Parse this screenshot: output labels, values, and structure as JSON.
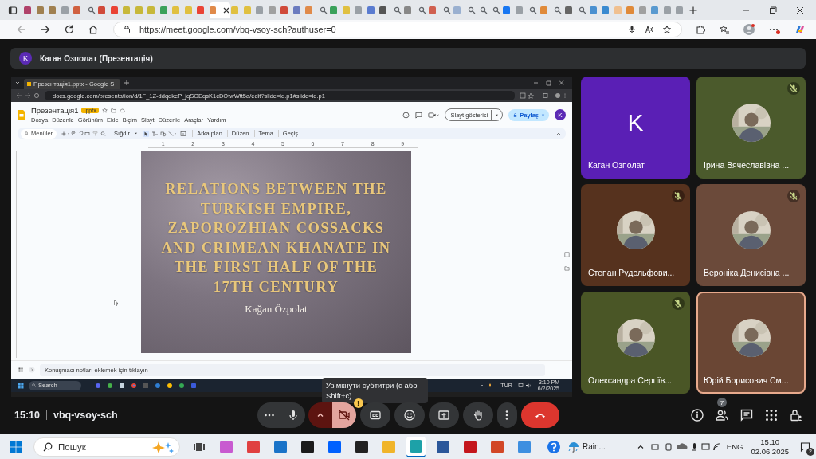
{
  "browser": {
    "tabs": [
      {
        "kind": "page",
        "color": "#b0426a",
        "selected": false
      },
      {
        "kind": "page",
        "color": "#a08050",
        "selected": false
      },
      {
        "kind": "page",
        "color": "#a08050",
        "selected": false
      },
      {
        "kind": "page",
        "color": "#9aa0a6",
        "selected": false
      },
      {
        "kind": "page",
        "color": "#d06040",
        "selected": false
      },
      {
        "kind": "search",
        "color": "#5f6368",
        "selected": false
      },
      {
        "kind": "page",
        "color": "#d04a3a",
        "selected": false
      },
      {
        "kind": "page",
        "color": "#ea4335",
        "selected": false
      },
      {
        "kind": "page",
        "color": "#c7b83a",
        "selected": false
      },
      {
        "kind": "page",
        "color": "#c7b83a",
        "selected": false
      },
      {
        "kind": "page",
        "color": "#c7b83a",
        "selected": false
      },
      {
        "kind": "page",
        "color": "#3aa15a",
        "selected": false
      },
      {
        "kind": "page",
        "color": "#e0c040",
        "selected": false
      },
      {
        "kind": "page",
        "color": "#e0c040",
        "selected": false
      },
      {
        "kind": "page",
        "color": "#ea4335",
        "selected": false
      },
      {
        "kind": "page",
        "color": "#e08a4a",
        "selected": true
      },
      {
        "kind": "page",
        "color": "#e0c040",
        "selected": false
      },
      {
        "kind": "page",
        "color": "#e0c040",
        "selected": false
      },
      {
        "kind": "page",
        "color": "#9aa0a6",
        "selected": false
      },
      {
        "kind": "page",
        "color": "#a0a0a0",
        "selected": false
      },
      {
        "kind": "page",
        "color": "#d04a3a",
        "selected": false
      },
      {
        "kind": "page",
        "color": "#6b7bbf",
        "selected": false
      },
      {
        "kind": "page",
        "color": "#e08a4a",
        "selected": false
      },
      {
        "kind": "search",
        "color": "#5f6368",
        "selected": false
      },
      {
        "kind": "page",
        "color": "#3aa15a",
        "selected": false
      },
      {
        "kind": "page",
        "color": "#e0c040",
        "selected": false
      },
      {
        "kind": "page",
        "color": "#9aa0a6",
        "selected": false
      },
      {
        "kind": "page",
        "color": "#5a7bd0",
        "selected": false
      },
      {
        "kind": "page",
        "color": "#555555",
        "selected": false
      },
      {
        "kind": "search",
        "color": "#5f6368",
        "selected": false
      },
      {
        "kind": "page",
        "color": "#888888",
        "selected": false
      },
      {
        "kind": "search",
        "color": "#5f6368",
        "selected": false
      },
      {
        "kind": "page",
        "color": "#d06050",
        "selected": false
      },
      {
        "kind": "search",
        "color": "#5f6368",
        "selected": false
      },
      {
        "kind": "page",
        "color": "#9ab0d0",
        "selected": false
      },
      {
        "kind": "search",
        "color": "#5f6368",
        "selected": false
      },
      {
        "kind": "search",
        "color": "#5f6368",
        "selected": false
      },
      {
        "kind": "search",
        "color": "#5f6368",
        "selected": false
      },
      {
        "kind": "page",
        "color": "#1877f2",
        "selected": false
      },
      {
        "kind": "page",
        "color": "#9aa0a6",
        "selected": false
      },
      {
        "kind": "search",
        "color": "#5f6368",
        "selected": false
      },
      {
        "kind": "page",
        "color": "#e08a3a",
        "selected": false
      },
      {
        "kind": "search",
        "color": "#5f6368",
        "selected": false
      },
      {
        "kind": "page",
        "color": "#666666",
        "selected": false
      },
      {
        "kind": "search",
        "color": "#5f6368",
        "selected": false
      },
      {
        "kind": "page",
        "color": "#4a90d0",
        "selected": false
      },
      {
        "kind": "page",
        "color": "#3a8ad0",
        "selected": false
      },
      {
        "kind": "page",
        "color": "#f0c090",
        "selected": false
      },
      {
        "kind": "page",
        "color": "#e08a3a",
        "selected": false
      },
      {
        "kind": "page",
        "color": "#a0a0a0",
        "selected": false
      },
      {
        "kind": "page",
        "color": "#5a9ad0",
        "selected": false
      },
      {
        "kind": "page",
        "color": "#9aa0a6",
        "selected": false
      },
      {
        "kind": "page",
        "color": "#9aa0a6",
        "selected": false
      }
    ],
    "url": "https://meet.google.com/vbq-vsoy-sch?authuser=0"
  },
  "meeting": {
    "presenter_initial": "K",
    "presenter_label": "Каган Озполат (Презентація)",
    "time": "15:10",
    "code": "vbq-vsoy-sch",
    "participants_count": "7"
  },
  "shared_screen": {
    "tab_title": "Презентація1.pptx - Google S",
    "url": "docs.google.com/presentation/d/1F_1Z-ddqqkeP_jqSOEqsK1cDOtwWtt5a/edit?slide=id.p1#slide=id.p1",
    "doc_title": "Презентація1",
    "doc_badge": ".pptx",
    "menus": [
      "Dosya",
      "Düzenle",
      "Görünüm",
      "Ekle",
      "Biçim",
      "Slayt",
      "Düzenle",
      "Araçlar",
      "Yardım"
    ],
    "slideshow_button": "Slayt gösterisi",
    "share_button": "Paylaş",
    "account_initial": "K",
    "search_menus": "Menüler",
    "zoom": "Sığdır",
    "toolbar_buttons": [
      "Arka plan",
      "Düzen",
      "Tema",
      "Geçiş"
    ],
    "ruler": [
      "1",
      "2",
      "3",
      "4",
      "5",
      "6",
      "7",
      "8",
      "9"
    ],
    "slide": {
      "title": "RELATIONS BETWEEN THE TURKISH EMPIRE, ZAPOROZHIAN COSSACKS AND CRIMEAN KHANATE IN THE FIRST HALF OF THE 17TH CENTURY",
      "author": "Kağan Özpolat"
    },
    "notes_placeholder": "Konuşmacı notları eklemek için tıklayın",
    "taskbar": {
      "search": "Search",
      "language": "TUR",
      "time": "3:10 PM",
      "date": "6/2/2025"
    }
  },
  "tooltip": "Увімкнути субтитри (с або Shift+c)",
  "participants": [
    {
      "name": "Каган Озполат",
      "color": "#5a1fb5",
      "kind": "letter",
      "initial": "K",
      "muted": false,
      "speaking": false
    },
    {
      "name": "Ірина Вячеславівна ...",
      "color": "#4b5a2c",
      "kind": "picture",
      "muted": true,
      "speaking": false
    },
    {
      "name": "Степан Рудольфови...",
      "color": "#56321e",
      "kind": "picture",
      "muted": true,
      "speaking": false
    },
    {
      "name": "Вероніка Денисівна ...",
      "color": "#6b4a3a",
      "kind": "picture",
      "muted": true,
      "speaking": false
    },
    {
      "name": "Олександра Сергіїв...",
      "color": "#4a5626",
      "kind": "picture",
      "muted": true,
      "speaking": false
    },
    {
      "name": "Юрій Борисович См...",
      "color": "#6a4634",
      "kind": "picture",
      "muted": false,
      "speaking": true
    }
  ],
  "controls": [
    {
      "kind": "more"
    },
    {
      "kind": "mic",
      "on": true
    },
    {
      "kind": "caret"
    },
    {
      "kind": "camera",
      "on": false,
      "warning": "!"
    },
    {
      "kind": "captions"
    },
    {
      "kind": "emoji"
    },
    {
      "kind": "present"
    },
    {
      "kind": "hand"
    },
    {
      "kind": "options"
    },
    {
      "kind": "end"
    }
  ],
  "taskbar": {
    "search": "Пошук",
    "apps": [
      {
        "kind": "taskview",
        "color": "#444444",
        "selected": false
      },
      {
        "kind": "app",
        "color": "#c85ad0",
        "selected": false
      },
      {
        "kind": "app",
        "color": "#e04040",
        "selected": false
      },
      {
        "kind": "app",
        "color": "#1a73c8",
        "selected": false
      },
      {
        "kind": "app",
        "color": "#1b1b1b",
        "selected": false
      },
      {
        "kind": "app",
        "color": "#0061fe",
        "selected": false
      },
      {
        "kind": "app",
        "color": "#222222",
        "selected": false
      },
      {
        "kind": "app",
        "color": "#f0b429",
        "selected": false
      },
      {
        "kind": "app",
        "color": "#1da1a8",
        "selected": true
      },
      {
        "kind": "app",
        "color": "#2b579a",
        "selected": false
      },
      {
        "kind": "app",
        "color": "#c4161c",
        "selected": false
      },
      {
        "kind": "app",
        "color": "#d24726",
        "selected": false
      },
      {
        "kind": "app",
        "color": "#3d8fe0",
        "selected": false
      }
    ],
    "weather": "Rain...",
    "language": "ENG",
    "time": "15:10",
    "date": "02.06.2025",
    "notifications": "2"
  }
}
